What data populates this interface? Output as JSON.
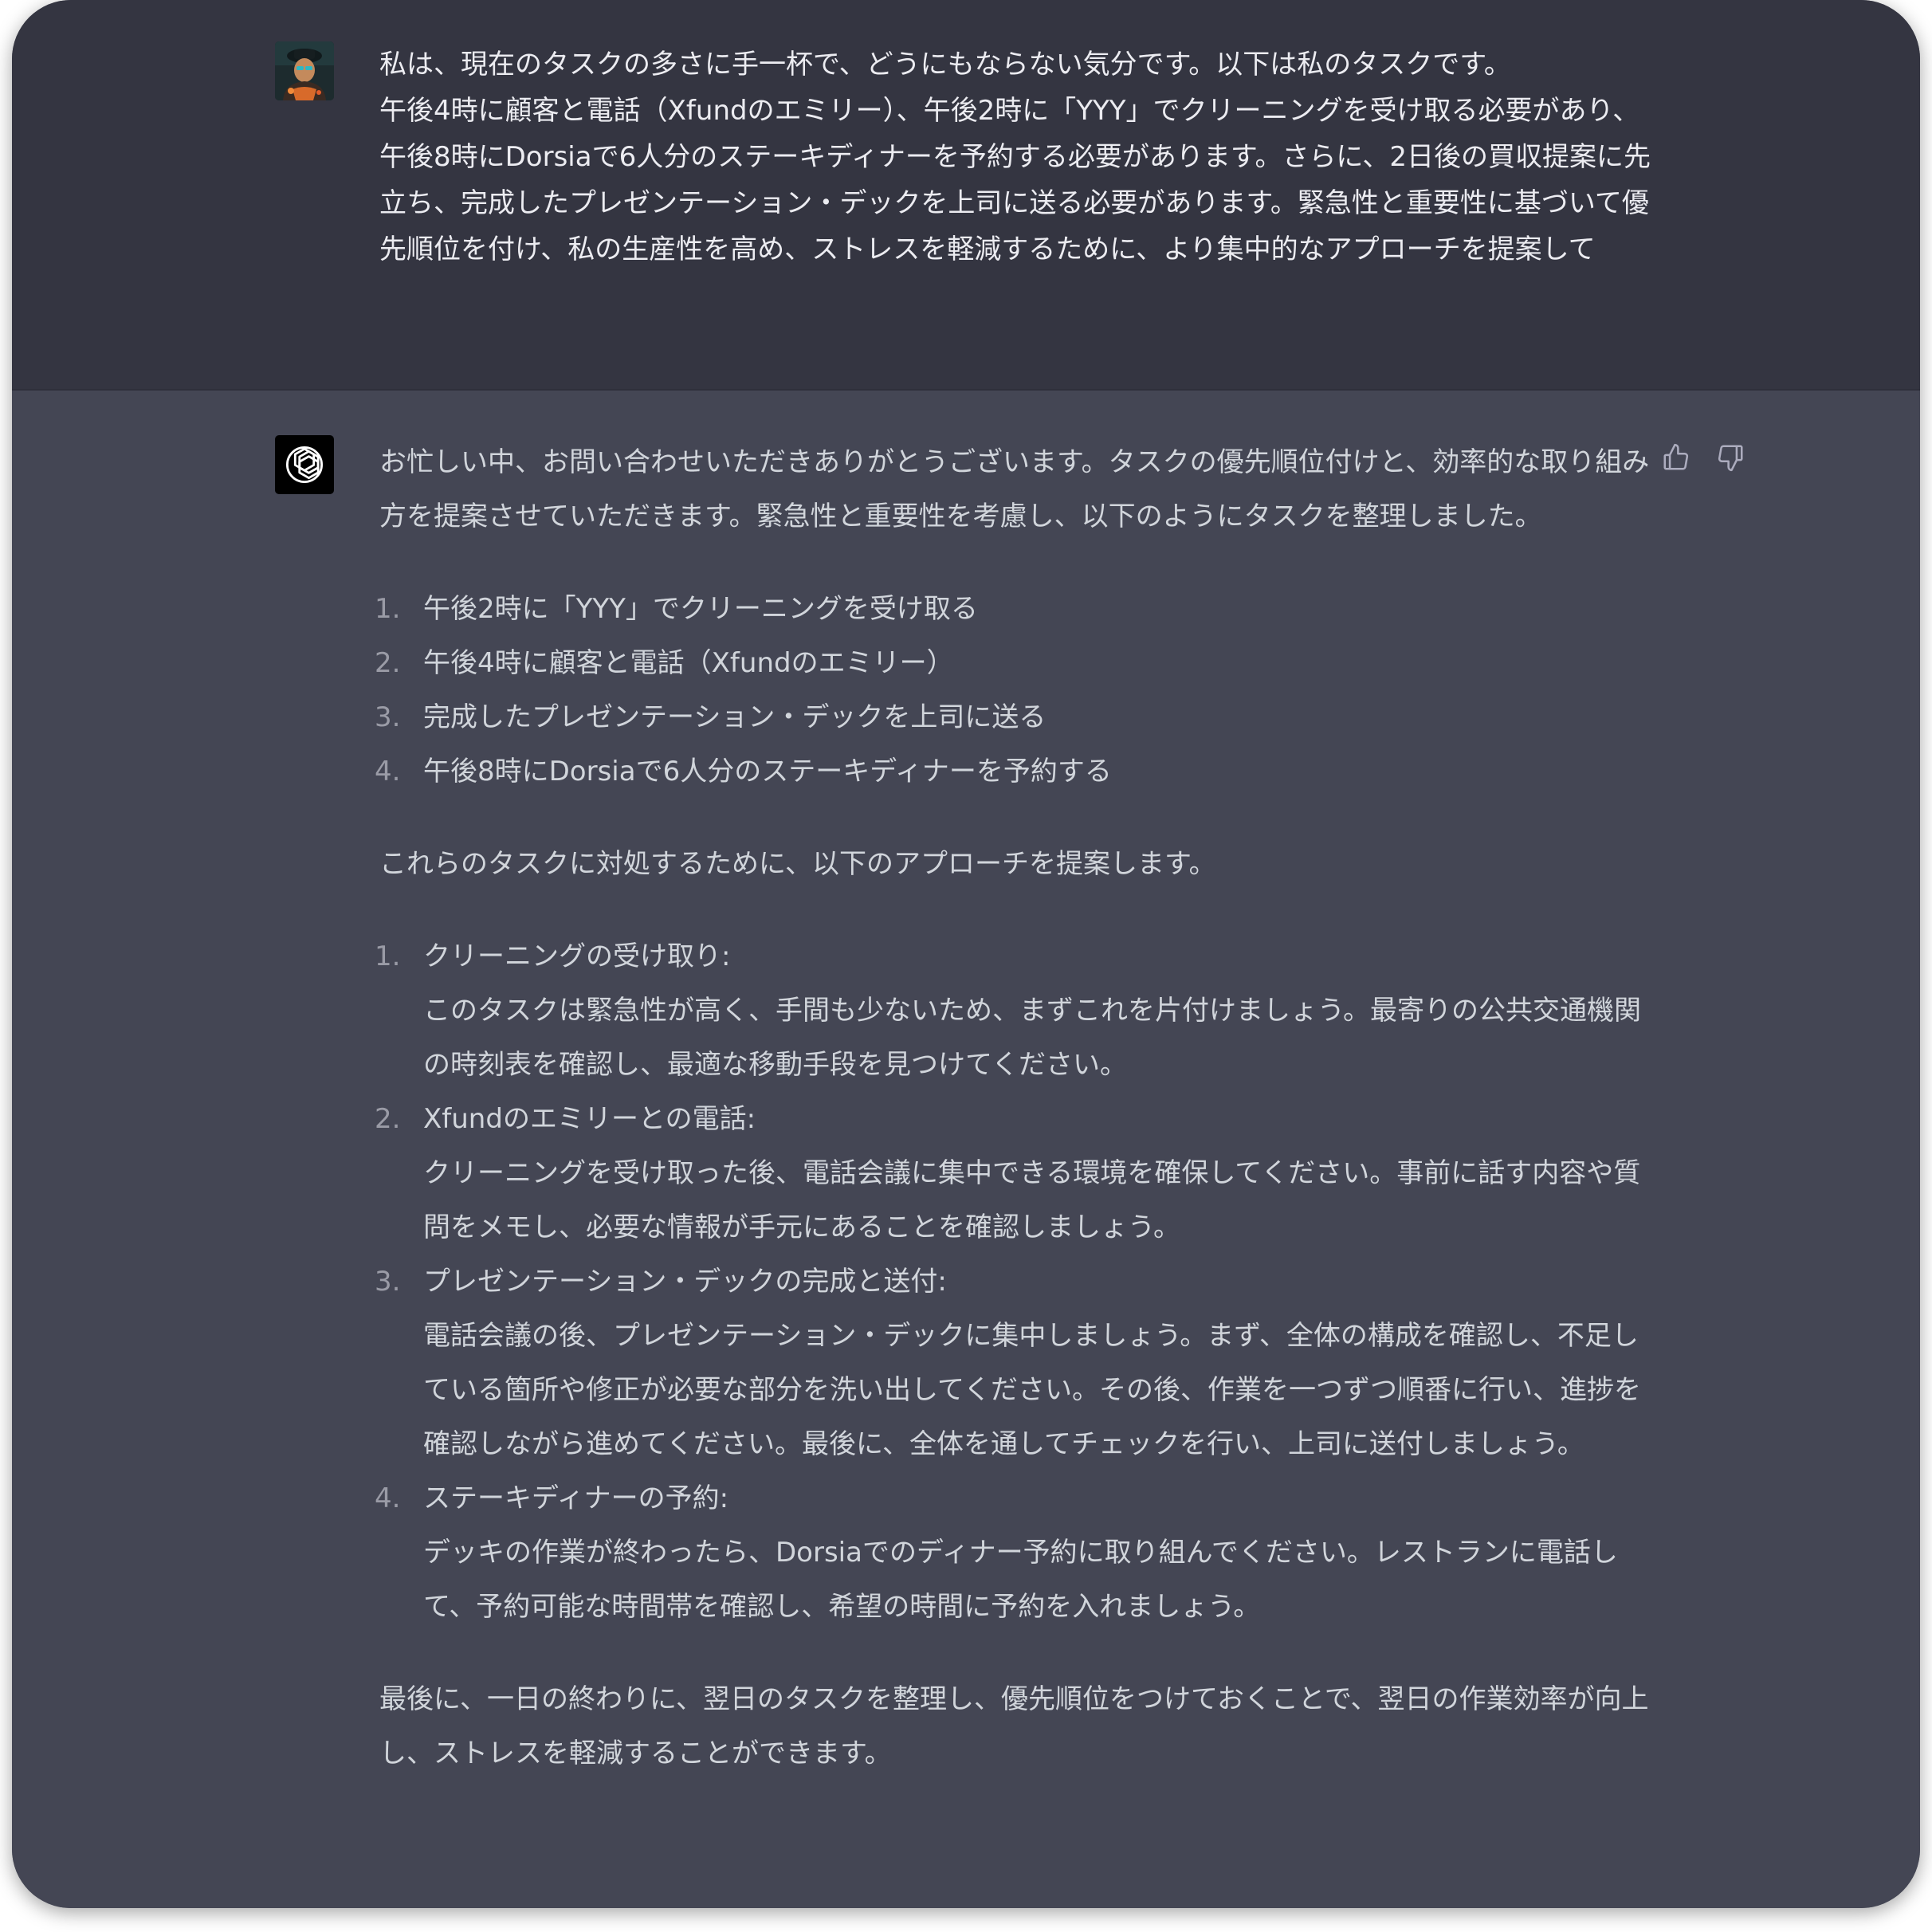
{
  "user": {
    "avatar_icon": "user-avatar-image",
    "message": "私は、現在のタスクの多さに手一杯で、どうにもならない気分です。以下は私のタスクです。\n午後4時に顧客と電話（Xfundのエミリー）、午後2時に「YYY」でクリーニングを受け取る必要があり、午後8時にDorsiaで6人分のステーキディナーを予約する必要があります。さらに、2日後の買収提案に先立ち、完成したプレゼンテーション・デックを上司に送る必要があります。緊急性と重要性に基づいて優先順位を付け、私の生産性を高め、ストレスを軽減するために、より集中的なアプローチを提案して"
  },
  "assistant": {
    "avatar_icon": "openai-logo-icon",
    "intro": "お忙しい中、お問い合わせいただきありがとうございます。タスクの優先順位付けと、効率的な取り組み方を提案させていただきます。緊急性と重要性を考慮し、以下のようにタスクを整理しました。",
    "task_list": [
      {
        "num": "1.",
        "text": "午後2時に「YYY」でクリーニングを受け取る"
      },
      {
        "num": "2.",
        "text": "午後4時に顧客と電話（Xfundのエミリー）"
      },
      {
        "num": "3.",
        "text": "完成したプレゼンテーション・デックを上司に送る"
      },
      {
        "num": "4.",
        "text": "午後8時にDorsiaで6人分のステーキディナーを予約する"
      }
    ],
    "approach_intro": "これらのタスクに対処するために、以下のアプローチを提案します。",
    "approach_list": [
      {
        "num": "1.",
        "title": "クリーニングの受け取り:",
        "body": "このタスクは緊急性が高く、手間も少ないため、まずこれを片付けましょう。最寄りの公共交通機関の時刻表を確認し、最適な移動手段を見つけてください。"
      },
      {
        "num": "2.",
        "title": "Xfundのエミリーとの電話:",
        "body": "クリーニングを受け取った後、電話会議に集中できる環境を確保してください。事前に話す内容や質問をメモし、必要な情報が手元にあることを確認しましょう。"
      },
      {
        "num": "3.",
        "title": "プレゼンテーション・デックの完成と送付:",
        "body": "電話会議の後、プレゼンテーション・デックに集中しましょう。まず、全体の構成を確認し、不足している箇所や修正が必要な部分を洗い出してください。その後、作業を一つずつ順番に行い、進捗を確認しながら進めてください。最後に、全体を通してチェックを行い、上司に送付しましょう。"
      },
      {
        "num": "4.",
        "title": "ステーキディナーの予約:",
        "body": "デッキの作業が終わったら、Dorsiaでのディナー予約に取り組んでください。レストランに電話して、予約可能な時間帯を確認し、希望の時間に予約を入れましょう。"
      }
    ],
    "closing": "最後に、一日の終わりに、翌日のタスクを整理し、優先順位をつけておくことで、翌日の作業効率が向上し、ストレスを軽減することができます。",
    "feedback": {
      "thumbs_up_icon": "thumbs-up-icon",
      "thumbs_down_icon": "thumbs-down-icon"
    }
  },
  "colors": {
    "user_bg": "#343541",
    "assistant_bg": "#444654",
    "text": "#d1d5db",
    "list_number": "#9a9ba6"
  }
}
